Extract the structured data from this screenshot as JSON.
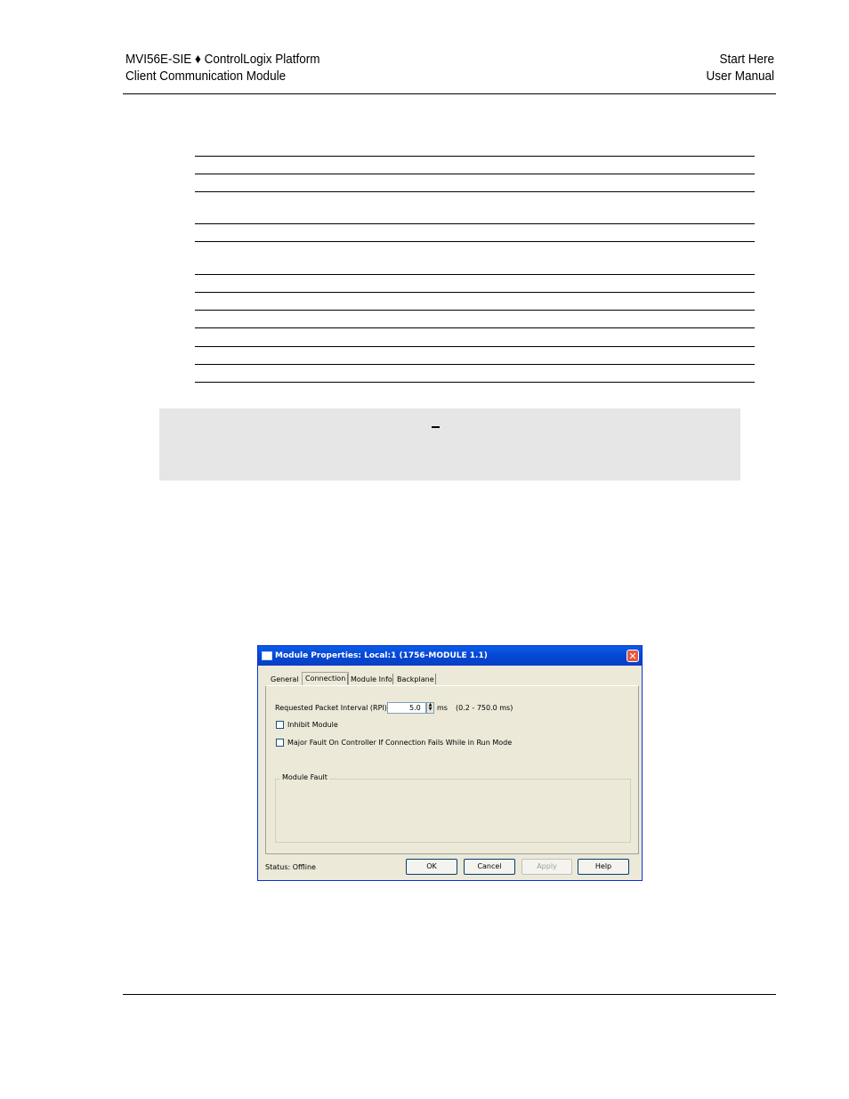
{
  "header": {
    "left_line1": "MVI56E-SIE ♦ ControlLogix Platform",
    "left_line2": "Client Communication Module",
    "right_line1": "Start Here",
    "right_line2": "User Manual"
  },
  "dialog": {
    "title": "Module Properties: Local:1 (1756-MODULE 1.1)",
    "close_glyph": "✕",
    "tabs": [
      "General",
      "Connection",
      "Module Info",
      "Backplane"
    ],
    "rpi_label": "Requested Packet Interval (RPI):",
    "rpi_value": "5.0",
    "rpi_unit": "ms",
    "rpi_range": "(0.2 - 750.0 ms)",
    "inhibit_label": "Inhibit Module",
    "major_fault_label": "Major Fault On Controller If Connection Fails While in Run Mode",
    "module_fault_label": "Module Fault",
    "status_text": "Status:  Offline",
    "buttons": {
      "ok": "OK",
      "cancel": "Cancel",
      "apply": "Apply",
      "help": "Help"
    }
  }
}
